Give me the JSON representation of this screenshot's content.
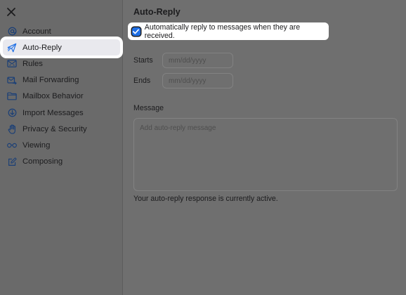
{
  "sidebar": {
    "items": [
      {
        "label": "Account",
        "icon": "at-icon"
      },
      {
        "label": "Auto-Reply",
        "icon": "paper-plane-icon",
        "active": true
      },
      {
        "label": "Rules",
        "icon": "rules-icon"
      },
      {
        "label": "Mail Forwarding",
        "icon": "forward-mail-icon"
      },
      {
        "label": "Mailbox Behavior",
        "icon": "folder-icon"
      },
      {
        "label": "Import Messages",
        "icon": "download-circle-icon"
      },
      {
        "label": "Privacy & Security",
        "icon": "hand-icon"
      },
      {
        "label": "Viewing",
        "icon": "glasses-icon"
      },
      {
        "label": "Composing",
        "icon": "compose-icon"
      }
    ]
  },
  "main": {
    "title": "Auto-Reply",
    "auto_reply_checkbox": {
      "label": "Automatically reply to messages when they are received.",
      "checked": true
    },
    "starts": {
      "label": "Starts",
      "placeholder": "mm/dd/yyyy"
    },
    "ends": {
      "label": "Ends",
      "placeholder": "mm/dd/yyyy"
    },
    "message": {
      "label": "Message",
      "placeholder": "Add auto-reply message"
    },
    "status": "Your auto-reply response is currently active."
  },
  "colors": {
    "accent": "#1f6fe5",
    "icon": "#1a3f77",
    "highlight": "#ffffff"
  }
}
